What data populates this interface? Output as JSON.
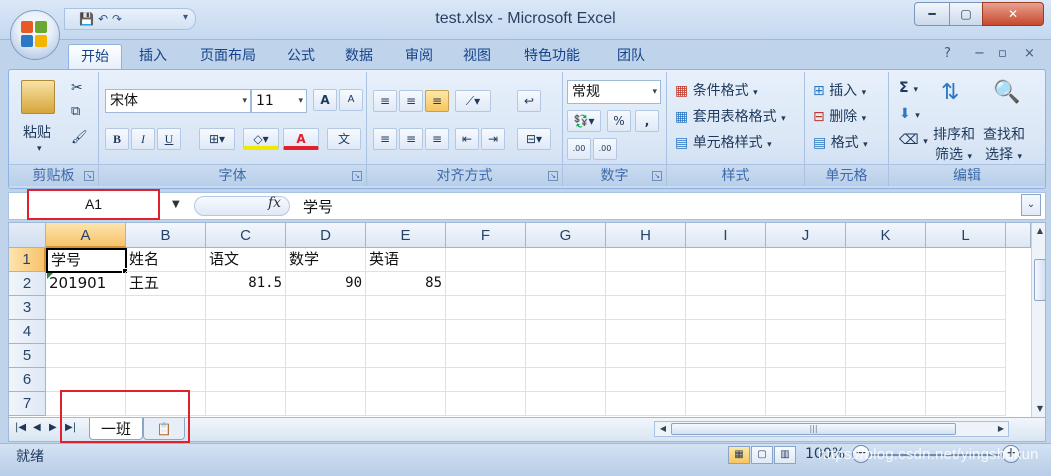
{
  "window": {
    "title": "test.xlsx - Microsoft Excel",
    "minimize": "━",
    "maximize": "▢",
    "close": "✕"
  },
  "qat": {
    "save": "💾",
    "undo": "↶",
    "redo": "↷",
    "more": "▾"
  },
  "tabs": [
    "开始",
    "插入",
    "页面布局",
    "公式",
    "数据",
    "审阅",
    "视图",
    "特色功能",
    "团队"
  ],
  "active_tab": "开始",
  "tab_right_icons": {
    "help": "?",
    "min": "−",
    "restore": "▫",
    "close": "×"
  },
  "ribbon": {
    "clipboard": {
      "label": "剪贴板",
      "paste": "粘贴"
    },
    "font": {
      "label": "字体",
      "font_name": "宋体",
      "font_size": "11",
      "bold": "B",
      "italic": "I",
      "underline": "U",
      "grow": "A",
      "shrink": "A",
      "fill": "A",
      "color": "A",
      "wen": "文"
    },
    "alignment": {
      "label": "对齐方式"
    },
    "number": {
      "label": "数字",
      "format": "常规",
      "percent": "%",
      "comma": ",",
      "inc_decimal": ".00",
      "dec_decimal": ".00"
    },
    "styles": {
      "label": "样式",
      "conditional": "条件格式",
      "table": "套用表格格式",
      "cell_styles": "单元格样式"
    },
    "cells": {
      "label": "单元格",
      "insert": "插入",
      "delete": "删除",
      "format": "格式"
    },
    "editing": {
      "label": "编辑",
      "sigma": "Σ",
      "sort": "排序和",
      "sort2": "筛选",
      "find": "查找和",
      "find2": "选择"
    }
  },
  "formula_bar": {
    "name_box": "A1",
    "fx": "fx",
    "content": "学号"
  },
  "columns": [
    "A",
    "B",
    "C",
    "D",
    "E",
    "F",
    "G",
    "H",
    "I",
    "J",
    "K",
    "L"
  ],
  "rows": [
    "1",
    "2",
    "3",
    "4",
    "5",
    "6",
    "7"
  ],
  "cells": {
    "A1": "学号",
    "B1": "姓名",
    "C1": "语文",
    "D1": "数学",
    "E1": "英语",
    "A2": "201901",
    "B2": "王五",
    "C2": "81.5",
    "D2": "90",
    "E2": "85"
  },
  "sheets": {
    "active": "一班"
  },
  "status": {
    "ready": "就绪",
    "zoom": "100%",
    "zoom_minus": "−",
    "zoom_plus": "+"
  },
  "watermark": "https://blog.csdn.net/yingshukun",
  "colors": {
    "selection_red": "#e0202a",
    "header_selected": "#f7c36a",
    "ribbon_bg": "#dbe7f6"
  }
}
